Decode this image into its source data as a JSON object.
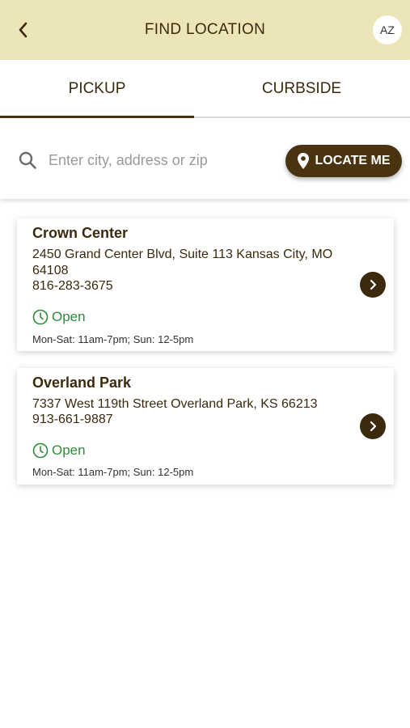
{
  "header": {
    "title": "FIND LOCATION",
    "avatar_initials": "AZ",
    "back_icon": "chevron-left-icon"
  },
  "tabs": [
    {
      "label": "PICKUP",
      "active": true
    },
    {
      "label": "CURBSIDE",
      "active": false
    }
  ],
  "search": {
    "placeholder": "Enter city, address or zip",
    "value": "",
    "locate_label": "LOCATE ME"
  },
  "locations": [
    {
      "name": "Crown Center",
      "address": "2450 Grand Center Blvd, Suite 113 Kansas City, MO 64108",
      "phone": "816-283-3675",
      "status": "Open",
      "hours": "Mon-Sat: 11am-7pm; Sun: 12-5pm"
    },
    {
      "name": "Overland Park",
      "address": "7337 West 119th Street Overland Park, KS 66213",
      "phone": "913-661-9887",
      "status": "Open",
      "hours": "Mon-Sat: 11am-7pm; Sun: 12-5pm"
    }
  ],
  "colors": {
    "header_bg": "#ece5b8",
    "brand_brown": "#4a3410",
    "text_brown": "#3b2a0e",
    "open_green": "#2e8b3a"
  }
}
